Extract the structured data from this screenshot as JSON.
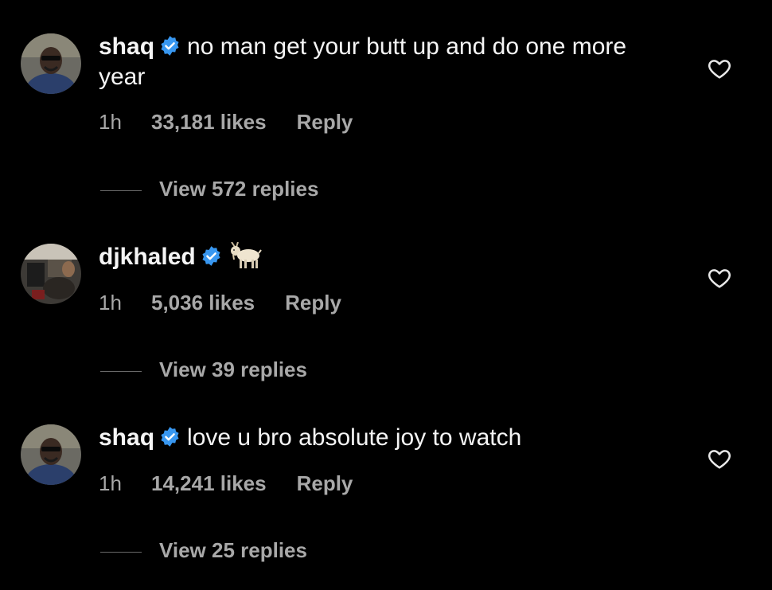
{
  "comments": [
    {
      "username": "shaq",
      "text": "no man get your butt up and do one more year",
      "time": "1h",
      "likes": "33,181 likes",
      "reply_label": "Reply",
      "view_replies": "View 572 replies",
      "avatar_icon": "shaq-avatar",
      "verified": true
    },
    {
      "username": "djkhaled",
      "text": "",
      "emoji_icon": "goat-emoji-icon",
      "time": "1h",
      "likes": "5,036 likes",
      "reply_label": "Reply",
      "view_replies": "View 39 replies",
      "avatar_icon": "djkhaled-avatar",
      "verified": true
    },
    {
      "username": "shaq",
      "text": "love u bro absolute joy to watch",
      "time": "1h",
      "likes": "14,241 likes",
      "reply_label": "Reply",
      "view_replies": "View 25 replies",
      "avatar_icon": "shaq-avatar",
      "verified": true
    }
  ],
  "colors": {
    "background": "#000000",
    "text": "#f5f5f5",
    "muted": "#a8a8a8",
    "verified_blue": "#3897f0"
  }
}
